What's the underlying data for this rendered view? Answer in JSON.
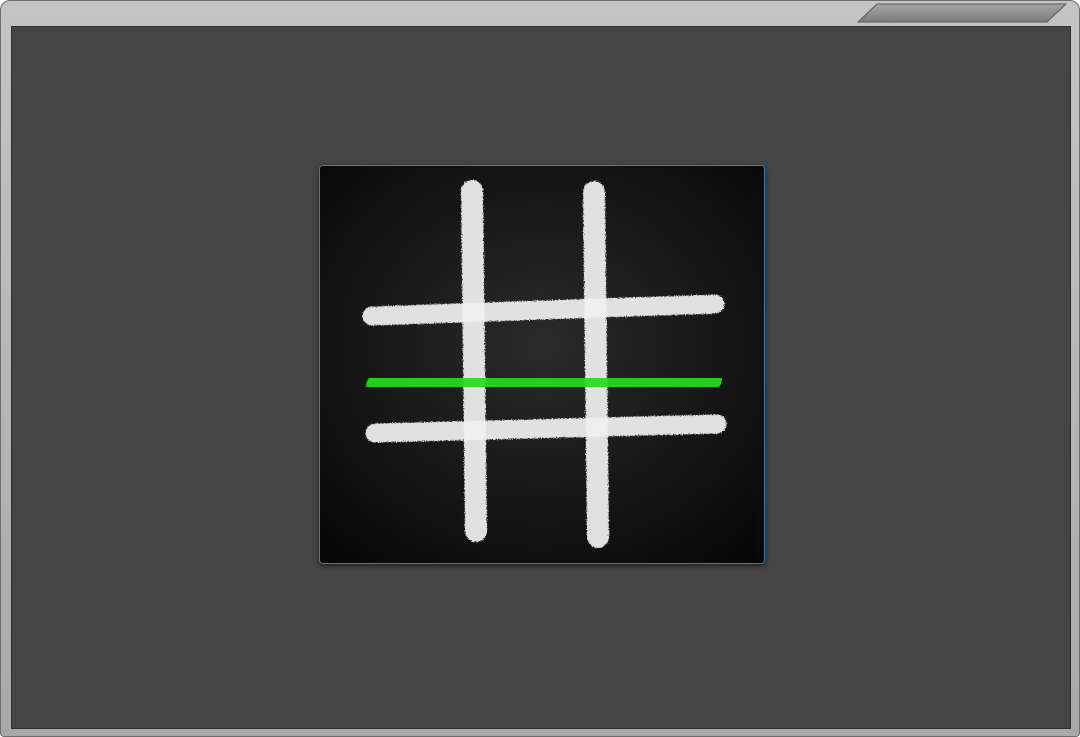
{
  "game": {
    "type": "tic-tac-toe",
    "board": {
      "rows": 3,
      "cols": 3,
      "cells": [
        [
          "",
          "",
          ""
        ],
        [
          "",
          "",
          ""
        ],
        [
          "",
          "",
          ""
        ]
      ],
      "grid_color": "#f0f0f0",
      "background_color": "#0c0c0c"
    },
    "win_line": {
      "orientation": "horizontal",
      "row": 2,
      "color": "#22dd1e"
    }
  },
  "colors": {
    "window_frame": "#b8b8b8",
    "viewport_background": "#454545",
    "board_border": "#3a7fb8"
  }
}
